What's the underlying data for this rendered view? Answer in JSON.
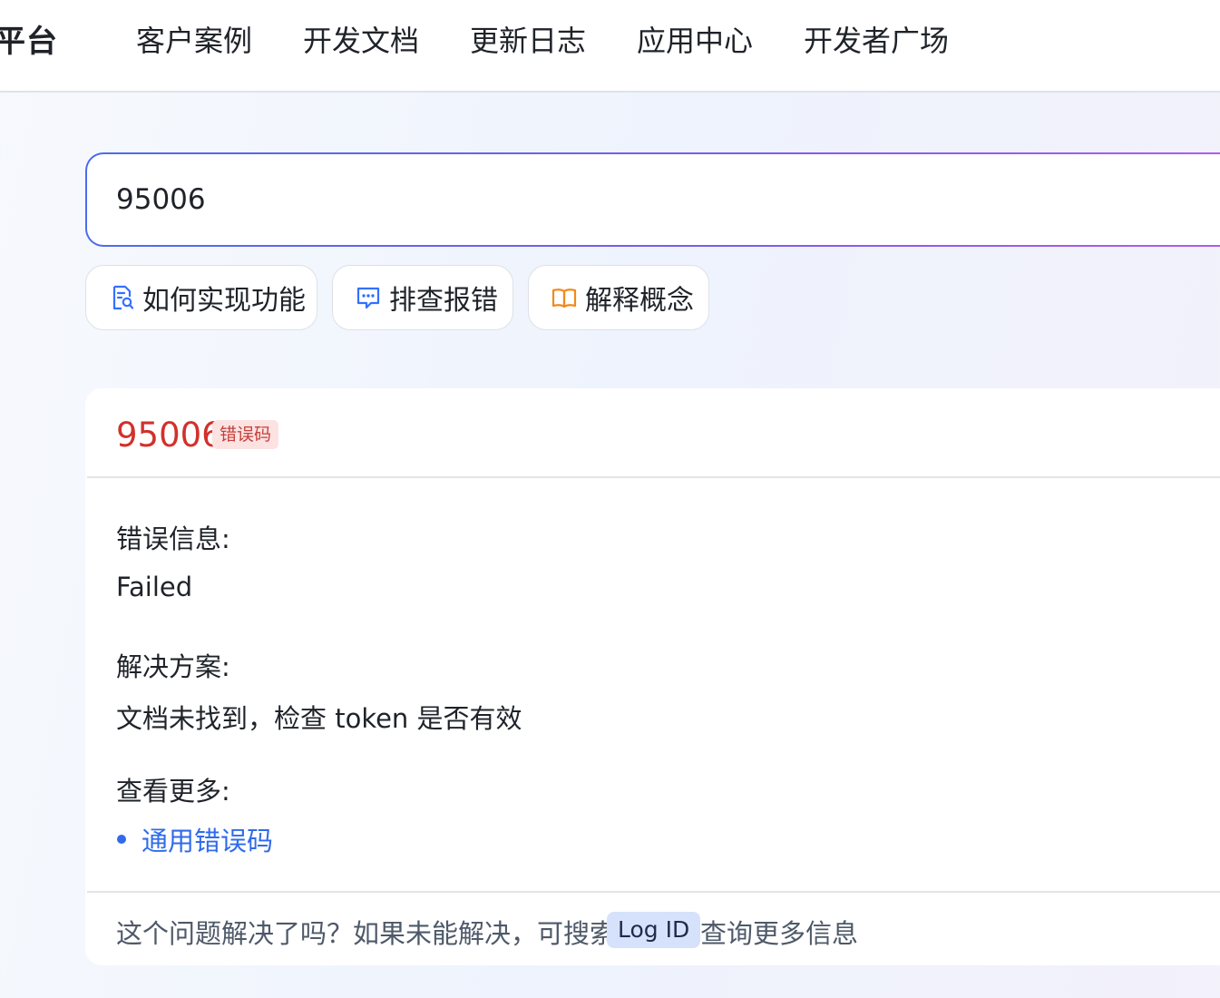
{
  "header": {
    "brand": "平台",
    "nav": [
      "客户案例",
      "开发文档",
      "更新日志",
      "应用中心",
      "开发者广场"
    ]
  },
  "search": {
    "value": "95006"
  },
  "chips": [
    {
      "label": "如何实现功能",
      "icon": "doc-search-icon",
      "color": "#3370ff"
    },
    {
      "label": "排查报错",
      "icon": "chat-bubble-icon",
      "color": "#3370ff"
    },
    {
      "label": "解释概念",
      "icon": "open-book-icon",
      "color": "#f08a1a"
    }
  ],
  "result": {
    "code": "95006",
    "tag": "错误码",
    "error_label": "错误信息:",
    "error_value": "Failed",
    "solution_label": "解决方案:",
    "solution_value": "文档未找到，检查 token 是否有效",
    "more_label": "查看更多:",
    "more_links": [
      "通用错误码"
    ],
    "footer_question": "这个问题解决了吗？如果未能解决，可搜索",
    "footer_badge": "Log ID",
    "footer_tail": "查询更多信息"
  },
  "colors": {
    "error_red": "#d2312b",
    "link_blue": "#2f6bea",
    "accent_gradient_start": "#4e6af0",
    "accent_gradient_end": "#b25ee8"
  }
}
